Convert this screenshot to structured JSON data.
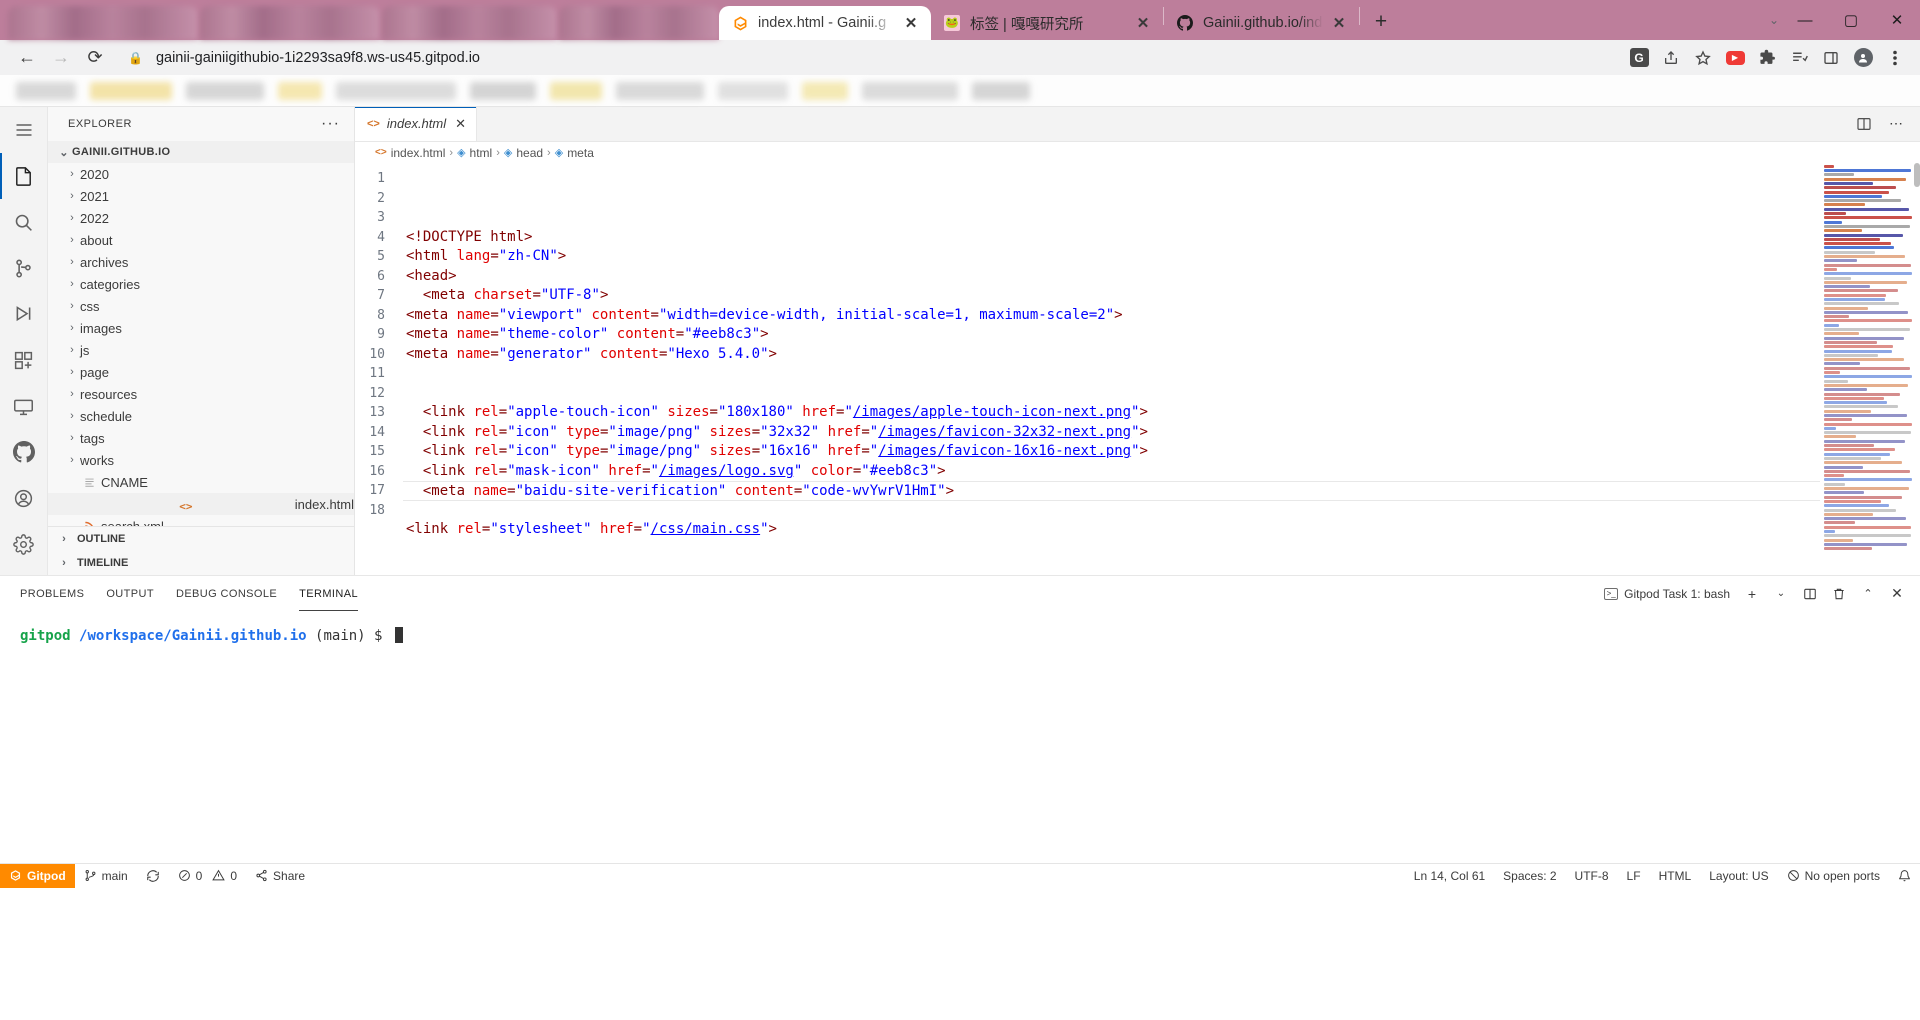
{
  "browser": {
    "tabs": [
      {
        "title": "index.html - Gainii.g",
        "favicon": "gitpod-icon",
        "active": true,
        "blurred": false
      },
      {
        "title": "标签 | 嘎嘎研究所",
        "favicon": "site-icon",
        "active": false,
        "blurred": false
      },
      {
        "title": "Gainii.github.io/inde",
        "favicon": "github-icon",
        "active": false,
        "blurred": false
      }
    ],
    "new_tab_label": "+",
    "window_controls": {
      "chevron": "⌄",
      "minimize": "—",
      "maximize": "▢",
      "close": "✕"
    },
    "nav": {
      "back": "←",
      "forward": "→",
      "reload": "⟳"
    },
    "url": "gainii-gainiigithubio-1i2293sa9f8.ws-us45.gitpod.io",
    "lock_icon": "lock-icon",
    "toolbar_icons": [
      "translate-icon",
      "share-icon",
      "bookmark-star-icon",
      "youtube-icon",
      "extensions-icon",
      "reading-list-icon",
      "sidepanel-icon",
      "profile-avatar-icon",
      "chrome-menu-icon"
    ],
    "titlebar_color": "#bd7e9b",
    "accent_color": "#005fb8"
  },
  "activitybar": {
    "items": [
      {
        "name": "menu",
        "glyph": "≡"
      },
      {
        "name": "explorer",
        "glyph": "files",
        "active": true
      },
      {
        "name": "search",
        "glyph": "⌕"
      },
      {
        "name": "source-control",
        "glyph": "branch"
      },
      {
        "name": "run-and-debug",
        "glyph": "▷"
      },
      {
        "name": "extensions",
        "glyph": "blocks"
      },
      {
        "name": "remote-explorer",
        "glyph": "remote"
      },
      {
        "name": "github",
        "glyph": "github"
      }
    ],
    "bottom": [
      {
        "name": "accounts",
        "glyph": "person"
      },
      {
        "name": "settings",
        "glyph": "gear"
      }
    ]
  },
  "sidebar": {
    "title": "EXPLORER",
    "more_actions": "···",
    "root": {
      "label": "GAINII.GITHUB.IO",
      "expanded": true
    },
    "files": [
      {
        "label": "2020",
        "type": "folder"
      },
      {
        "label": "2021",
        "type": "folder"
      },
      {
        "label": "2022",
        "type": "folder"
      },
      {
        "label": "about",
        "type": "folder"
      },
      {
        "label": "archives",
        "type": "folder"
      },
      {
        "label": "categories",
        "type": "folder"
      },
      {
        "label": "css",
        "type": "folder"
      },
      {
        "label": "images",
        "type": "folder"
      },
      {
        "label": "js",
        "type": "folder"
      },
      {
        "label": "page",
        "type": "folder"
      },
      {
        "label": "resources",
        "type": "folder"
      },
      {
        "label": "schedule",
        "type": "folder"
      },
      {
        "label": "tags",
        "type": "folder"
      },
      {
        "label": "works",
        "type": "folder"
      },
      {
        "label": "CNAME",
        "type": "file",
        "icon": "text-file-icon"
      },
      {
        "label": "index.html",
        "type": "file",
        "icon": "html-file-icon",
        "selected": true
      },
      {
        "label": "search.xml",
        "type": "file",
        "icon": "xml-file-icon"
      }
    ],
    "sections": [
      {
        "label": "OUTLINE"
      },
      {
        "label": "TIMELINE"
      }
    ]
  },
  "editor": {
    "tab": {
      "label": "index.html",
      "icon": "html-file-icon",
      "close": "✕"
    },
    "tab_actions": [
      "split-editor-icon",
      "more-actions-icon"
    ],
    "breadcrumb": [
      "index.html",
      "html",
      "head",
      "meta"
    ],
    "lines": [
      {
        "n": 1,
        "text": "<!DOCTYPE html>"
      },
      {
        "n": 2,
        "text": "<html lang=\"zh-CN\">"
      },
      {
        "n": 3,
        "text": "<head>"
      },
      {
        "n": 4,
        "text": "  <meta charset=\"UTF-8\">"
      },
      {
        "n": 5,
        "text": "<meta name=\"viewport\" content=\"width=device-width, initial-scale=1, maximum-scale=2\">"
      },
      {
        "n": 6,
        "text": "<meta name=\"theme-color\" content=\"#eeb8c3\">"
      },
      {
        "n": 7,
        "text": "<meta name=\"generator\" content=\"Hexo 5.4.0\">"
      },
      {
        "n": 8,
        "text": ""
      },
      {
        "n": 9,
        "text": ""
      },
      {
        "n": 10,
        "text": "  <link rel=\"apple-touch-icon\" sizes=\"180x180\" href=\"/images/apple-touch-icon-next.png\">"
      },
      {
        "n": 11,
        "text": "  <link rel=\"icon\" type=\"image/png\" sizes=\"32x32\" href=\"/images/favicon-32x32-next.png\">"
      },
      {
        "n": 12,
        "text": "  <link rel=\"icon\" type=\"image/png\" sizes=\"16x16\" href=\"/images/favicon-16x16-next.png\">"
      },
      {
        "n": 13,
        "text": "  <link rel=\"mask-icon\" href=\"/images/logo.svg\" color=\"#eeb8c3\">"
      },
      {
        "n": 14,
        "text": "  <meta name=\"baidu-site-verification\" content=\"code-wvYwrV1HmI\">"
      },
      {
        "n": 15,
        "text": ""
      },
      {
        "n": 16,
        "text": "<link rel=\"stylesheet\" href=\"/css/main.css\">"
      },
      {
        "n": 17,
        "text": ""
      },
      {
        "n": 18,
        "text": ""
      }
    ]
  },
  "panel": {
    "tabs": [
      {
        "label": "PROBLEMS",
        "active": false
      },
      {
        "label": "OUTPUT",
        "active": false
      },
      {
        "label": "DEBUG CONSOLE",
        "active": false
      },
      {
        "label": "TERMINAL",
        "active": true
      }
    ],
    "terminal_selector": "Gitpod Task 1: bash",
    "actions": [
      "new-terminal-icon",
      "terminal-dropdown-icon",
      "split-terminal-icon",
      "kill-terminal-icon",
      "maximize-panel-icon",
      "close-panel-icon"
    ],
    "prompt": {
      "user": "gitpod",
      "path": "/workspace/Gainii.github.io",
      "branch": "(main)",
      "symbol": "$"
    }
  },
  "statusbar": {
    "gitpod_label": "Gitpod",
    "branch": "main",
    "sync_icon": "sync-icon",
    "errors": "0",
    "warnings": "0",
    "share_label": "Share",
    "cursor_position": "Ln 14, Col 61",
    "spaces": "Spaces: 2",
    "encoding": "UTF-8",
    "eol": "LF",
    "language": "HTML",
    "layout": "Layout: US",
    "ports": "No open ports"
  }
}
